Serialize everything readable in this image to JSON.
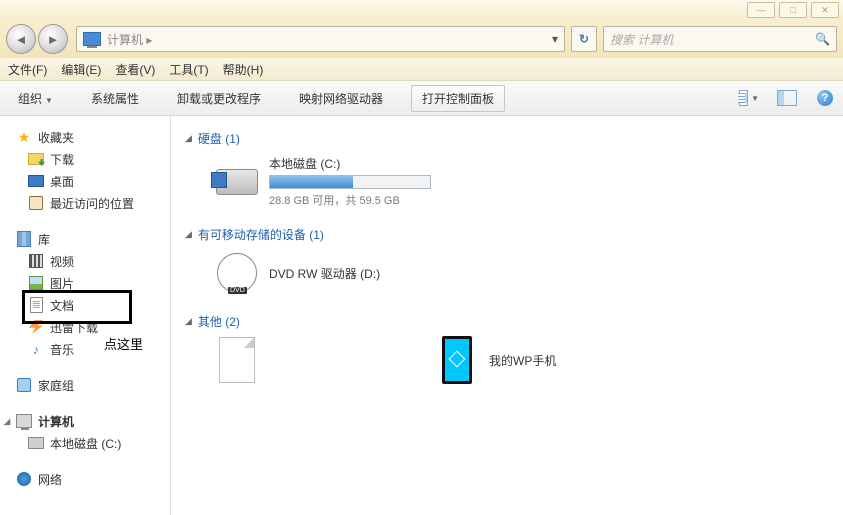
{
  "title_buttons": {
    "min": "—",
    "max": "□",
    "close": "✕"
  },
  "nav": {
    "back": "◄",
    "fwd": "►",
    "path": "计算机 ▸",
    "dropdown": "▾",
    "refresh": "↻"
  },
  "search": {
    "placeholder": "搜索 计算机",
    "icon": "🔍"
  },
  "menu": {
    "file": "文件(F)",
    "edit": "编辑(E)",
    "view": "查看(V)",
    "tools": "工具(T)",
    "help": "帮助(H)"
  },
  "toolbar": {
    "organize": "组织",
    "sysprops": "系统属性",
    "uninstall": "卸载或更改程序",
    "mapnet": "映射网络驱动器",
    "ctrlpanel": "打开控制面板",
    "dd": "▼",
    "help": "?"
  },
  "sidebar": {
    "fav": "收藏夹",
    "dl": "下载",
    "desktop": "桌面",
    "recent": "最近访问的位置",
    "lib": "库",
    "video": "视频",
    "pics": "图片",
    "docs": "文档",
    "xl": "迅雷下载",
    "music": "音乐",
    "homegroup": "家庭组",
    "computer": "计算机",
    "cdrive": "本地磁盘 (C:)",
    "network": "网络"
  },
  "annotation": "点这里",
  "groups": {
    "hdd": {
      "title": "硬盘 (1)",
      "drive": {
        "name": "本地磁盘 (C:)",
        "free": "28.8 GB 可用，共 59.5 GB",
        "pct": 52
      }
    },
    "removable": {
      "title": "有可移动存储的设备 (1)",
      "dvd": "DVD RW 驱动器 (D:)"
    },
    "other": {
      "title": "其他 (2)",
      "blank": "",
      "phone": "我的WP手机"
    }
  }
}
